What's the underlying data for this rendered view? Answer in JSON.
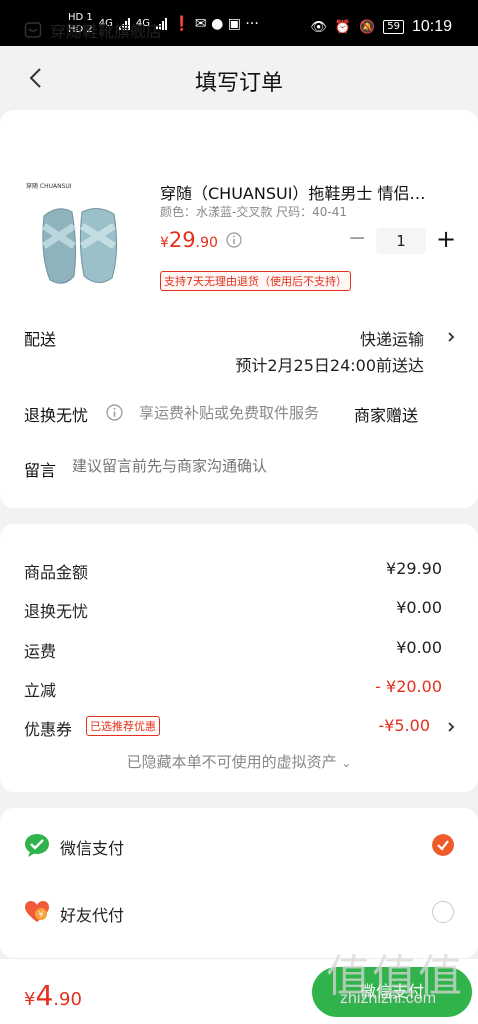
{
  "status_bar": {
    "time": "10:19",
    "battery": "59",
    "network_1": "HD 1",
    "network_2": "HD 2",
    "signal_1": "4G",
    "signal_2": "4G"
  },
  "nav": {
    "title": "填写订单"
  },
  "shop": {
    "name": "穿随鞋靴旗舰店"
  },
  "product": {
    "brand_mark": "穿随 CHUANSUI",
    "title": "穿随（CHUANSUI）拖鞋男士 情侣…",
    "spec": "颜色：水漾蓝-交叉款  尺码：40-41",
    "price_currency": "¥",
    "price_int": "29",
    "price_dec": ".90",
    "quantity": "1",
    "return_tag": "支持7天无理由退货（使用后不支持）"
  },
  "shipping": {
    "label": "配送",
    "method": "快递运输",
    "eta": "预计2月25日24:00前送达"
  },
  "return_service": {
    "label": "退换无忧",
    "note": "享运费补贴或免费取件服务",
    "value": "商家赠送"
  },
  "memo": {
    "label": "留言",
    "placeholder": "建议留言前先与商家沟通确认"
  },
  "summary": {
    "rows": [
      {
        "label": "商品金额",
        "value": "¥29.90"
      },
      {
        "label": "退换无忧",
        "value": "¥0.00"
      },
      {
        "label": "运费",
        "value": "¥0.00"
      },
      {
        "label": "立减",
        "value": "- ¥20.00"
      },
      {
        "label": "优惠券",
        "value": "-¥5.00"
      }
    ],
    "coupon_tag": "已选推荐优惠",
    "hidden_assets": "已隐藏本单不可使用的虚拟资产"
  },
  "payment": {
    "options": [
      {
        "label": "微信支付",
        "selected": true
      },
      {
        "label": "好友代付",
        "selected": false
      }
    ]
  },
  "bottom": {
    "currency": "¥",
    "total_int": "4",
    "total_dec": ".90",
    "pay_button": "微信支付"
  },
  "watermark": {
    "chars": "值值值",
    "url": "zhizhizhi.com"
  },
  "colors": {
    "accent_red": "#e4301c",
    "wechat_green": "#2fb34a",
    "radio_orange": "#ee5a28"
  }
}
